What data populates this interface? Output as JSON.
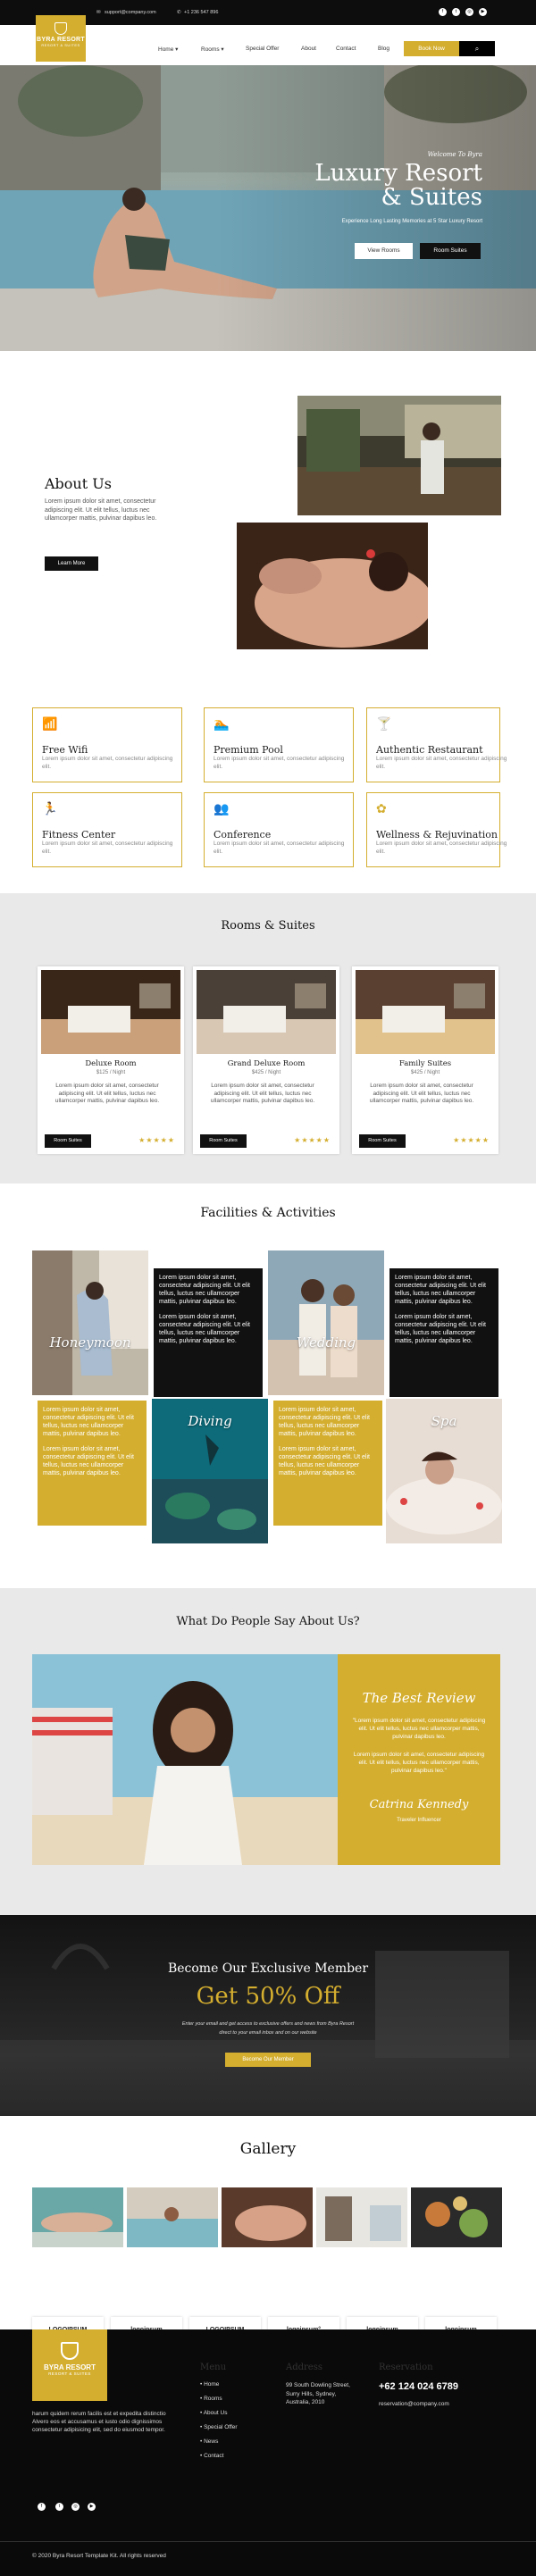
{
  "topbar": {
    "email": "support@company.com",
    "phone": "+1 236 547 896",
    "social": [
      "facebook-icon",
      "twitter-icon",
      "instagram-icon",
      "youtube-icon"
    ]
  },
  "logo": {
    "line1": "BYRA RESORT",
    "line2": "RESORT & SUITES"
  },
  "nav": {
    "items": [
      "Home",
      "Rooms",
      "Special Offer",
      "About",
      "Contact",
      "Blog"
    ],
    "book": "Book Now"
  },
  "hero": {
    "eyebrow": "Welcome To Byra",
    "title_line1": "Luxury Resort",
    "title_line2": "& Suites",
    "subtitle": "Experience Long Lasting Memories at 5 Star Luxury Resort",
    "btn_view": "View Rooms",
    "btn_rooms": "Room Suites"
  },
  "about": {
    "title": "About Us",
    "text": "Lorem ipsum dolor sit amet, consectetur adipiscing elit. Ut elit tellus, luctus nec ullamcorper mattis, pulvinar dapibus leo.",
    "button": "Learn More"
  },
  "features": [
    {
      "icon": "wifi-icon",
      "glyph": "📶",
      "title": "Free Wifi",
      "desc": "Lorem ipsum dolor sit amet, consectetur adipiscing elit."
    },
    {
      "icon": "pool-icon",
      "glyph": "🏊",
      "title": "Premium Pool",
      "desc": "Lorem ipsum dolor sit amet, consectetur adipiscing elit."
    },
    {
      "icon": "cocktail-icon",
      "glyph": "🍸",
      "title": "Authentic Restaurant",
      "desc": "Lorem ipsum dolor sit amet, consectetur adipiscing elit."
    },
    {
      "icon": "running-icon",
      "glyph": "🏃",
      "title": "Fitness Center",
      "desc": "Lorem ipsum dolor sit amet, consectetur adipiscing elit."
    },
    {
      "icon": "users-icon",
      "glyph": "👥",
      "title": "Conference",
      "desc": "Lorem ipsum dolor sit amet, consectetur adipiscing elit."
    },
    {
      "icon": "lotus-icon",
      "glyph": "✿",
      "title": "Wellness & Rejuvination",
      "desc": "Lorem ipsum dolor sit amet, consectetur adipiscing elit."
    }
  ],
  "rooms": {
    "title": "Rooms & Suites",
    "items": [
      {
        "name": "Deluxe Room",
        "price": "$125 / Night",
        "desc": "Lorem ipsum dolor sit amet, consectetur adipiscing elit. Ut elit tellus, luctus nec ullamcorper mattis, pulvinar dapibus leo.",
        "button": "Room Suites",
        "rating": 5
      },
      {
        "name": "Grand Deluxe Room",
        "price": "$425 / Night",
        "desc": "Lorem ipsum dolor sit amet, consectetur adipiscing elit. Ut elit tellus, luctus nec ullamcorper mattis, pulvinar dapibus leo.",
        "button": "Room Suites",
        "rating": 5
      },
      {
        "name": "Family Suites",
        "price": "$425 / Night",
        "desc": "Lorem ipsum dolor sit amet, consectetur adipiscing elit. Ut elit tellus, luctus nec ullamcorper mattis, pulvinar dapibus leo.",
        "button": "Room Suites",
        "rating": 5
      }
    ]
  },
  "facilities": {
    "title": "Facilities & Activities",
    "honeymoon": "Honeymoon",
    "wedding": "Wedding",
    "diving": "Diving",
    "spa": "Spa",
    "text_a": "Lorem ipsum dolor sit amet, consectetur adipiscing elit. Ut elit tellus, luctus nec ullamcorper mattis, pulvinar dapibus leo.",
    "text_b": "Lorem ipsum dolor sit amet, consectetur adipiscing elit. Ut elit tellus, luctus nec ullamcorper mattis, pulvinar dapibus leo."
  },
  "testimonial": {
    "title": "What Do People Say About Us?",
    "heading": "The Best Review",
    "quote1": "\"Lorem ipsum dolor sit amet, consectetur adipiscing elit. Ut elit tellus, luctus nec ullamcorper mattis, pulvinar dapibus leo.",
    "quote2": "Lorem ipsum dolor sit amet, consectetur adipiscing elit. Ut elit tellus, luctus nec ullamcorper mattis, pulvinar dapibus leo.\"",
    "signature": "Catrina Kennedy",
    "role": "Traveler Influencer"
  },
  "member": {
    "title": "Become Our Exclusive Member",
    "offer": "Get 50% Off",
    "line1": "Enter your email and get access to exclusive offers and news from Byra Resort",
    "line2": "direct to your email inbox and on our website",
    "button": "Become Our Member"
  },
  "gallery": {
    "title": "Gallery"
  },
  "logos": [
    "LOGOIPSUM",
    "logoipsum",
    "LOGOIPSUM",
    "logoipsum°",
    "logoipsum",
    "logoipsum"
  ],
  "footer": {
    "about": "harum quidem rerum facilis est et expedita distinctio Alvero eos et accusamus et iusto odio dignissimos consectetur adipisicing elit, sed do eiusmod tempor.",
    "menu_title": "Menu",
    "menu": [
      "Home",
      "Rooms",
      "About Us",
      "Special Offer",
      "News",
      "Contact"
    ],
    "address_title": "Address",
    "address": [
      "99 South Dowling Street,",
      "Surry Hills, Sydney,",
      "Australia, 2010"
    ],
    "reservation_title": "Reservation",
    "phone": "+62 124 024 6789",
    "email": "reservation@company.com",
    "copyright": "© 2020 Byra Resort Template Kit. All rights reserved"
  }
}
